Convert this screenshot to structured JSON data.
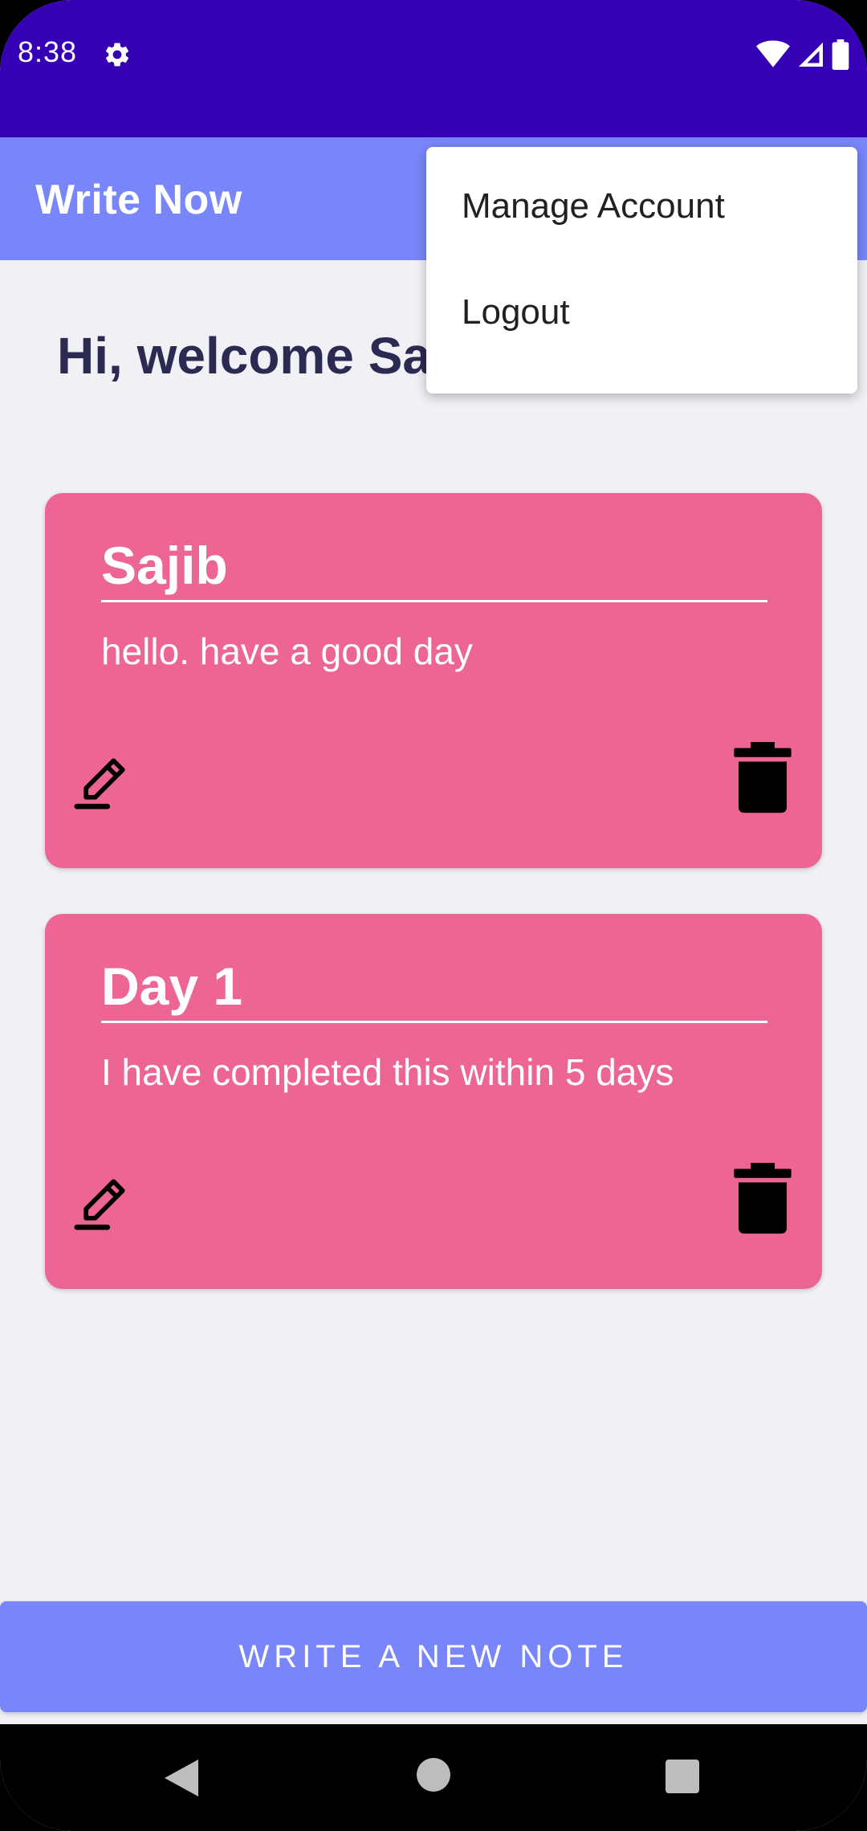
{
  "status_bar": {
    "time": "8:38",
    "background": "#3600B4"
  },
  "app_bar": {
    "title": "Write Now",
    "background": "#7886FA"
  },
  "greeting": {
    "text": "Hi, welcome Sa"
  },
  "notes": [
    {
      "title": "Sajib",
      "body": "hello. have a good day",
      "edit_icon": "pencil-edit-icon",
      "delete_icon": "trash-icon"
    },
    {
      "title": "Day 1",
      "body": "I have completed this within 5 days",
      "edit_icon": "pencil-edit-icon",
      "delete_icon": "trash-icon"
    }
  ],
  "card_color": "#EC6593",
  "new_note_button": {
    "label": "WRITE A NEW NOTE"
  },
  "overflow_menu": {
    "items": [
      "Manage Account",
      "Logout"
    ]
  },
  "nav_bar": {
    "icons": [
      "back-icon",
      "home-icon",
      "recents-icon"
    ]
  }
}
